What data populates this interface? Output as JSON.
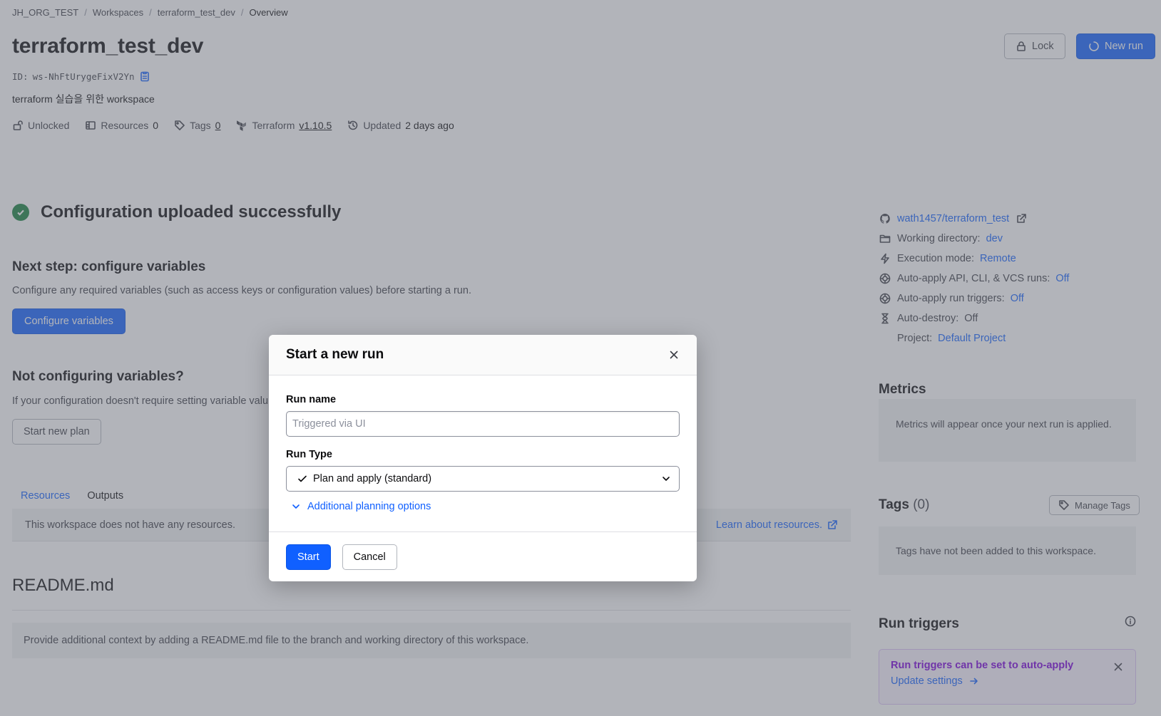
{
  "breadcrumb": [
    "JH_ORG_TEST",
    "Workspaces",
    "terraform_test_dev",
    "Overview"
  ],
  "workspace": {
    "title": "terraform_test_dev",
    "id_label": "ID:",
    "id": "ws-NhFtUrygeFixV2Yn",
    "description": "terraform 실습을 위한 workspace"
  },
  "meta": {
    "lock_status": "Unlocked",
    "resources_label": "Resources",
    "resources_count": "0",
    "tags_label": "Tags",
    "tags_count": "0",
    "terraform_label": "Terraform",
    "terraform_version": "v1.10.5",
    "updated_label": "Updated",
    "updated_value": "2 days ago"
  },
  "header_actions": {
    "lock": "Lock",
    "new_run": "New run"
  },
  "main": {
    "success": "Configuration uploaded successfully",
    "next_step_title": "Next step: configure variables",
    "next_step_text": "Configure any required variables (such as access keys or configuration values) before starting a run.",
    "configure_button": "Configure variables",
    "not_config_title": "Not configuring variables?",
    "not_config_text": "If your configuration doesn't require setting variable valu",
    "start_plan_button": "Start new plan",
    "tabs": [
      "Resources",
      "Outputs"
    ],
    "no_resources": "This workspace does not have any resources.",
    "learn_resources": "Learn about resources.",
    "readme_title": "README.md",
    "readme_text": "Provide additional context by adding a README.md file to the branch and working directory of this workspace."
  },
  "sidebar": {
    "repo": "wath1457/terraform_test",
    "working_dir_label": "Working directory:",
    "working_dir": "dev",
    "exec_mode_label": "Execution mode:",
    "exec_mode": "Remote",
    "auto_apply_label": "Auto-apply API, CLI, & VCS runs:",
    "auto_apply": "Off",
    "auto_apply_triggers_label": "Auto-apply run triggers:",
    "auto_apply_triggers": "Off",
    "auto_destroy_label": "Auto-destroy:",
    "auto_destroy": "Off",
    "project_label": "Project:",
    "project": "Default Project",
    "metrics_title": "Metrics",
    "metrics_text": "Metrics will appear once your next run is applied.",
    "tags_title": "Tags",
    "tags_count": "(0)",
    "manage_tags": "Manage Tags",
    "tags_empty": "Tags have not been added to this workspace.",
    "run_triggers_title": "Run triggers",
    "run_triggers_alert": "Run triggers can be set to auto-apply",
    "update_settings": "Update settings"
  },
  "modal": {
    "title": "Start a new run",
    "run_name_label": "Run name",
    "run_name_placeholder": "Triggered via UI",
    "run_type_label": "Run Type",
    "run_type_value": "Plan and apply (standard)",
    "additional_options": "Additional planning options",
    "start": "Start",
    "cancel": "Cancel"
  },
  "colors": {
    "accent": "#1060ff",
    "success": "#15803d",
    "highlight_purple": "#7b00db"
  }
}
